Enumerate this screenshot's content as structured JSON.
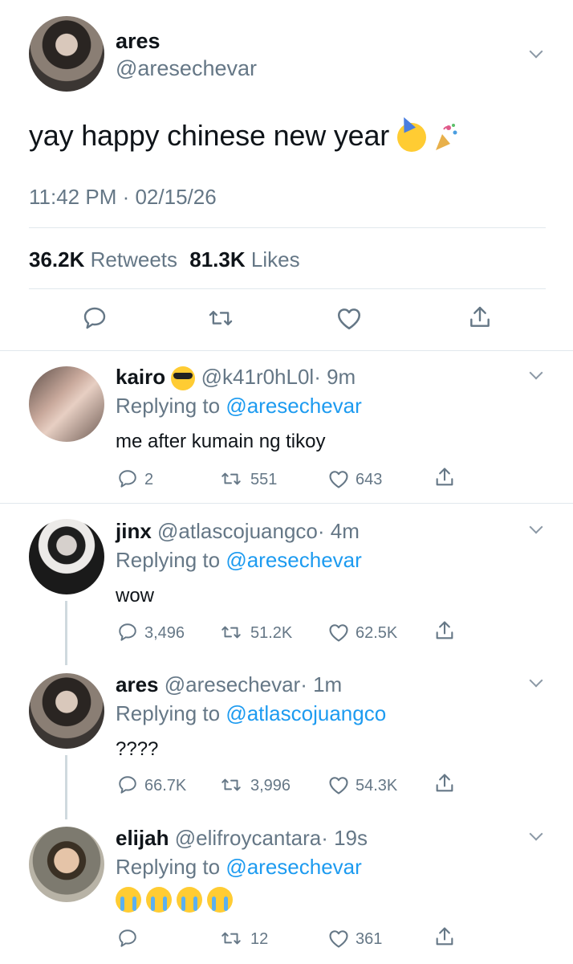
{
  "main_tweet": {
    "display_name": "ares",
    "handle": "@aresechevar",
    "text": "yay happy chinese new year",
    "emoji": [
      "partying-face-emoji",
      "confetti-popper-emoji"
    ],
    "timestamp": "11:42 PM · 02/15/26",
    "retweets_count": "36.2K",
    "retweets_label": "Retweets",
    "likes_count": "81.3K",
    "likes_label": "Likes"
  },
  "replies": [
    {
      "display_name": "kairo",
      "emoji": "sunglasses-emoji",
      "handle": "@k41r0hL0l",
      "time": "· 9m",
      "replying_label": "Replying to",
      "replying_to": "@aresechevar",
      "text": "me after kumain ng tikoy",
      "comments": "2",
      "retweets": "551",
      "likes": "643"
    },
    {
      "display_name": "jinx",
      "handle": "@atlascojuangco",
      "time": "· 4m",
      "replying_label": "Replying to",
      "replying_to": "@aresechevar",
      "text": "wow",
      "comments": "3,496",
      "retweets": "51.2K",
      "likes": "62.5K"
    },
    {
      "display_name": "ares",
      "handle": "@aresechevar",
      "time": "· 1m",
      "replying_label": "Replying to",
      "replying_to": "@atlascojuangco",
      "text": "????",
      "comments": "66.7K",
      "retweets": "3,996",
      "likes": "54.3K"
    },
    {
      "display_name": "elijah",
      "handle": "@elifroycantara",
      "time": "· 19s",
      "replying_label": "Replying to",
      "replying_to": "@aresechevar",
      "text_emoji": [
        "loudly-crying-face-emoji",
        "loudly-crying-face-emoji",
        "loudly-crying-face-emoji",
        "loudly-crying-face-emoji"
      ],
      "comments": "",
      "retweets": "12",
      "likes": "361"
    }
  ],
  "colors": {
    "text": "#0f1419",
    "secondary": "#657786",
    "link": "#1d9bf0",
    "divider": "#e1e8ed",
    "thread_line": "#cfd9de"
  }
}
